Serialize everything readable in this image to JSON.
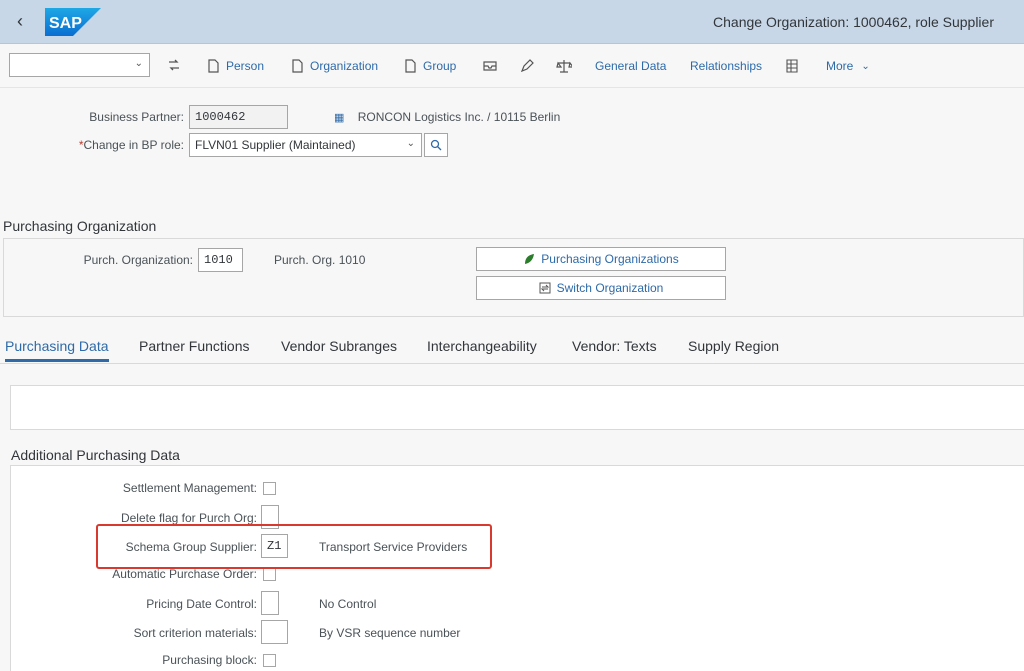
{
  "shell": {
    "title": "Change Organization: 1000462, role Supplier",
    "logo_text": "SAP"
  },
  "toolbar": {
    "select_value": "",
    "items": [
      {
        "label": "Person"
      },
      {
        "label": "Organization"
      },
      {
        "label": "Group"
      },
      {
        "label": "General Data"
      },
      {
        "label": "Relationships"
      },
      {
        "label": "More"
      }
    ]
  },
  "header": {
    "bp_label": "Business Partner:",
    "bp_value": "1000462",
    "bp_desc": "RONCON Logistics Inc. / 10115 Berlin",
    "role_required": "*",
    "role_label": "Change in BP role:",
    "role_value": "FLVN01 Supplier (Maintained)"
  },
  "purchasing_org": {
    "section_title": "Purchasing Organization",
    "label": "Purch. Organization:",
    "value": "1010",
    "desc": "Purch. Org. 1010",
    "btn_orgs": "Purchasing Organizations",
    "btn_switch": "Switch Organization"
  },
  "tabs": [
    {
      "label": "Purchasing Data",
      "active": true
    },
    {
      "label": "Partner Functions"
    },
    {
      "label": "Vendor Subranges"
    },
    {
      "label": "Interchangeability"
    },
    {
      "label": "Vendor: Texts"
    },
    {
      "label": "Supply Region"
    }
  ],
  "additional": {
    "section_title": "Additional Purchasing Data",
    "rows": [
      {
        "label": "Settlement Management:",
        "type": "checkbox",
        "checked": false
      },
      {
        "label": "Delete flag for Purch Org:",
        "type": "input",
        "value": ""
      },
      {
        "label": "Schema Group Supplier:",
        "type": "input",
        "value": "Z1",
        "desc": "Transport Service Providers"
      },
      {
        "label": "Automatic Purchase Order:",
        "type": "checkbox",
        "checked": false
      },
      {
        "label": "Pricing Date Control:",
        "type": "input",
        "value": "",
        "desc": "No Control"
      },
      {
        "label": "Sort criterion materials:",
        "type": "input",
        "value": "",
        "desc": "By VSR sequence number"
      },
      {
        "label": "Purchasing block:",
        "type": "checkbox",
        "checked": false
      }
    ]
  },
  "colors": {
    "shell_bg": "#c7d7e7",
    "link": "#2e6aa8",
    "sap_blue": "#0a6ed1",
    "highlight": "#d93a2f"
  }
}
